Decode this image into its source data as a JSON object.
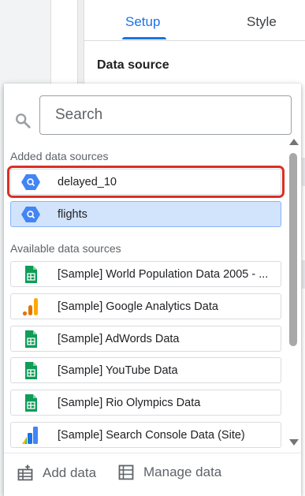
{
  "panel": {
    "tabs": [
      "Setup",
      "Style"
    ],
    "active_tab": "Setup",
    "heading": "Data source"
  },
  "popup": {
    "search_placeholder": "Search",
    "added_label": "Added data sources",
    "available_label": "Available data sources",
    "added_sources": [
      {
        "label": "delayed_10",
        "icon": "bigquery-icon",
        "highlighted": true
      },
      {
        "label": "flights",
        "icon": "bigquery-icon",
        "selected": true
      }
    ],
    "available_sources": [
      {
        "label": "[Sample] World Population Data 2005 - ...",
        "icon": "sheets-icon"
      },
      {
        "label": "[Sample] Google Analytics Data",
        "icon": "analytics-icon"
      },
      {
        "label": "[Sample] AdWords Data",
        "icon": "sheets-icon"
      },
      {
        "label": "[Sample] YouTube Data",
        "icon": "sheets-icon"
      },
      {
        "label": "[Sample] Rio Olympics Data",
        "icon": "sheets-icon"
      },
      {
        "label": "[Sample] Search Console Data (Site)",
        "icon": "search-console-icon"
      }
    ],
    "footer": {
      "add_label": "Add data",
      "manage_label": "Manage data"
    }
  },
  "colors": {
    "accent": "#1a73e8",
    "selected_bg": "#d2e3fc",
    "highlight_border": "#d93025"
  }
}
